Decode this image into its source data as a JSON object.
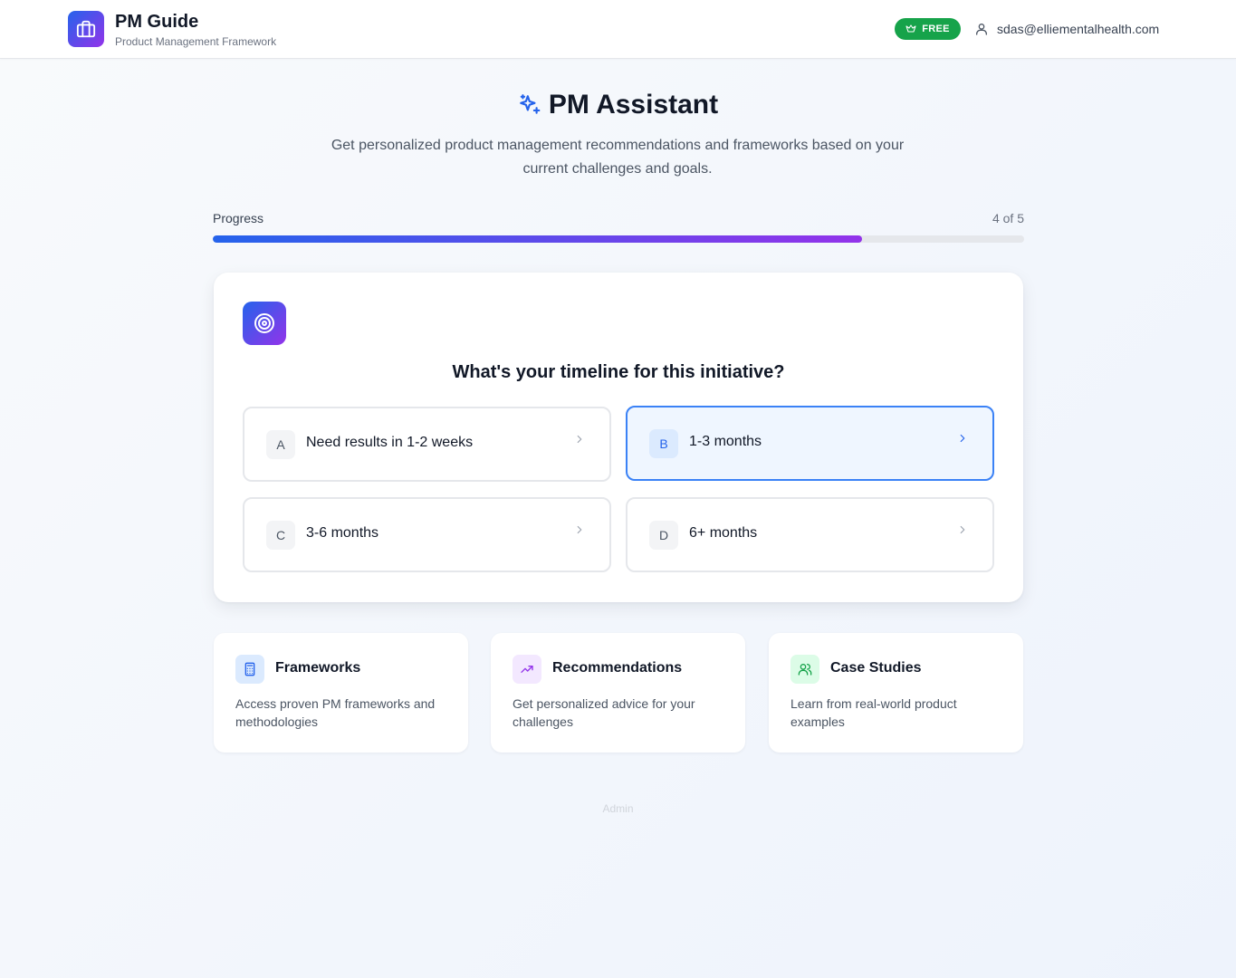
{
  "header": {
    "brand_title": "PM Guide",
    "brand_subtitle": "Product Management Framework",
    "plan_badge": "FREE",
    "user_email": "sdas@elliementalhealth.com"
  },
  "hero": {
    "title": "PM Assistant",
    "subtitle": "Get personalized product management recommendations and frameworks based on your current challenges and goals."
  },
  "progress": {
    "label": "Progress",
    "count_text": "4 of 5",
    "fraction": 0.8
  },
  "question": {
    "title": "What's your timeline for this initiative?",
    "options": [
      {
        "letter": "A",
        "label": "Need results in 1-2 weeks",
        "selected": false
      },
      {
        "letter": "B",
        "label": "1-3 months",
        "selected": true
      },
      {
        "letter": "C",
        "label": "3-6 months",
        "selected": false
      },
      {
        "letter": "D",
        "label": "6+ months",
        "selected": false
      }
    ]
  },
  "features": [
    {
      "title": "Frameworks",
      "description": "Access proven PM frameworks and methodologies",
      "icon": "calculator-icon",
      "color": "#2563eb",
      "bg": "#dbeafe"
    },
    {
      "title": "Recommendations",
      "description": "Get personalized advice for your challenges",
      "icon": "trending-up-icon",
      "color": "#9333ea",
      "bg": "#f3e8ff"
    },
    {
      "title": "Case Studies",
      "description": "Learn from real-world product examples",
      "icon": "users-icon",
      "color": "#16a34a",
      "bg": "#dcfce7"
    }
  ],
  "footer": {
    "admin_label": "Admin"
  },
  "colors": {
    "accent_blue": "#2563eb",
    "accent_purple": "#9333ea",
    "badge_green": "#16a34a"
  }
}
